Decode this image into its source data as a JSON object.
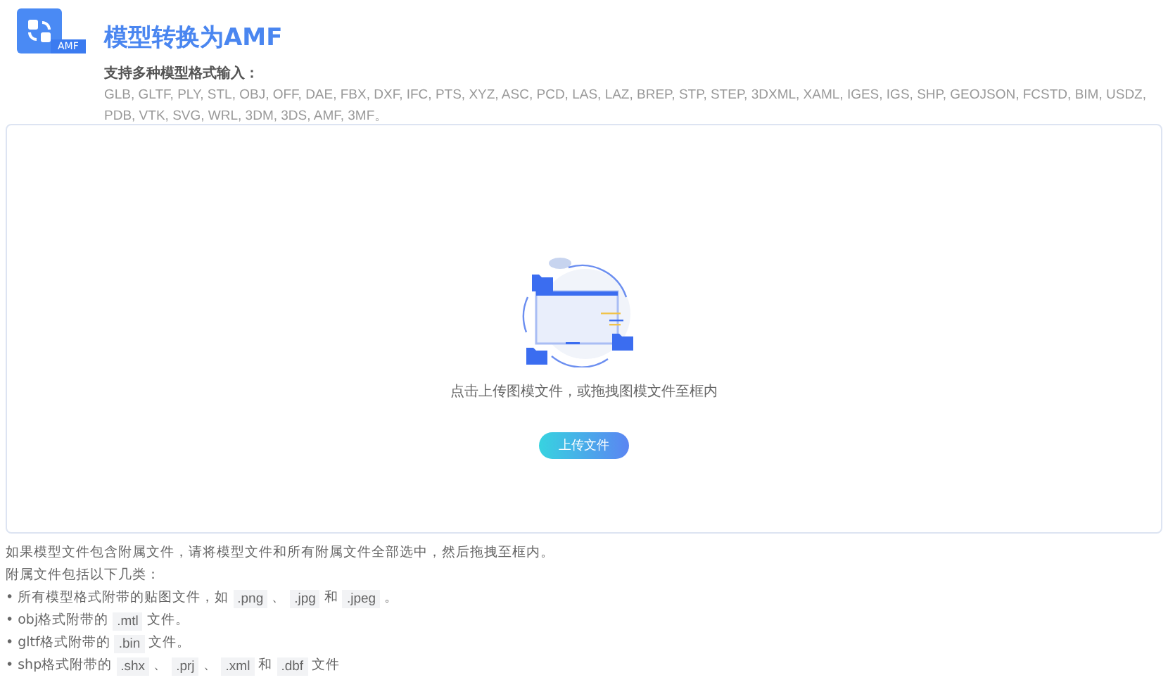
{
  "header": {
    "badge": "AMF",
    "title": "模型转换为AMF",
    "formats_label": "支持多种模型格式输入：",
    "formats": "GLB, GLTF, PLY, STL, OBJ, OFF, DAE, FBX, DXF, IFC, PTS, XYZ, ASC, PCD, LAS, LAZ, BREP, STP, STEP, 3DXML, XAML, IGES, IGS, SHP, GEOJSON, FCSTD, BIM, USDZ, PDB, VTK, SVG, WRL, 3DM, 3DS, AMF, 3MF。"
  },
  "dropzone": {
    "hint": "点击上传图模文件，或拖拽图模文件至框内",
    "button": "上传文件"
  },
  "notes": {
    "intro": "如果模型文件包含附属文件，请将模型文件和所有附属文件全部选中，然后拖拽至框内。",
    "list_label": "附属文件包括以下几类：",
    "bullets": [
      {
        "marker": "•",
        "parts": [
          {
            "kind": "text",
            "text": "所有模型格式附带的贴图文件，如"
          },
          {
            "kind": "code",
            "text": ".png"
          },
          {
            "kind": "text",
            "text": "、"
          },
          {
            "kind": "code",
            "text": ".jpg"
          },
          {
            "kind": "text",
            "text": "和"
          },
          {
            "kind": "code",
            "text": ".jpeg"
          },
          {
            "kind": "text",
            "text": "。"
          }
        ]
      },
      {
        "marker": "•",
        "parts": [
          {
            "kind": "text",
            "text": "obj格式附带的"
          },
          {
            "kind": "code",
            "text": ".mtl"
          },
          {
            "kind": "text",
            "text": "文件。"
          }
        ]
      },
      {
        "marker": "•",
        "parts": [
          {
            "kind": "text",
            "text": "gltf格式附带的"
          },
          {
            "kind": "code",
            "text": ".bin"
          },
          {
            "kind": "text",
            "text": "文件。"
          }
        ]
      },
      {
        "marker": "•",
        "parts": [
          {
            "kind": "text",
            "text": "shp格式附带的"
          },
          {
            "kind": "code",
            "text": ".shx"
          },
          {
            "kind": "text",
            "text": "、"
          },
          {
            "kind": "code",
            "text": ".prj"
          },
          {
            "kind": "text",
            "text": "、"
          },
          {
            "kind": "code",
            "text": ".xml"
          },
          {
            "kind": "text",
            "text": "和"
          },
          {
            "kind": "code",
            "text": ".dbf"
          },
          {
            "kind": "text",
            "text": "文件"
          }
        ]
      }
    ]
  }
}
